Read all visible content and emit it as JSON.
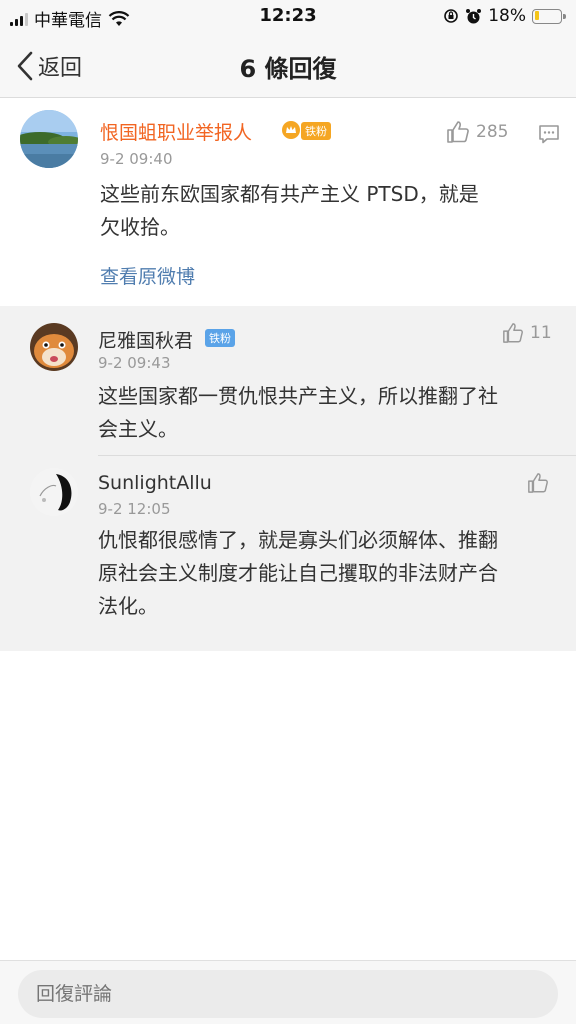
{
  "status_bar": {
    "carrier": "中華電信",
    "time": "12:23",
    "battery_percent": "18%",
    "battery_level": 0.18
  },
  "nav": {
    "back_label": "返回",
    "title": "6 條回復"
  },
  "main_comment": {
    "username": "恨国蛆职业举报人",
    "badge": "铁粉",
    "timestamp": "9-2 09:40",
    "text_line1": "这些前东欧国家都有共产主义 PTSD，就是",
    "text_line2": "欠收拾。",
    "likes": "285",
    "view_original": "查看原微博"
  },
  "replies": [
    {
      "username": "尼雅国秋君",
      "badge": "铁粉",
      "timestamp": "9-2 09:43",
      "text_line1": "这些国家都一贯仇恨共产主义，所以推翻了社",
      "text_line2": "会主义。",
      "likes": "11"
    },
    {
      "username": "SunlightAllu",
      "timestamp": "9-2 12:05",
      "text_line1": "仇恨都很感情了，就是寡头们必须解体、推翻",
      "text_line2": "原社会主义制度才能让自己攫取的非法财产合",
      "text_line3": "法化。"
    }
  ],
  "bottom_bar": {
    "placeholder": "回復評論"
  },
  "colors": {
    "orange_username": "#f26522",
    "link_blue": "#507daf",
    "badge_orange": "#f5a623",
    "badge_blue": "#5aa3e8",
    "battery_yellow": "#f5c518"
  }
}
